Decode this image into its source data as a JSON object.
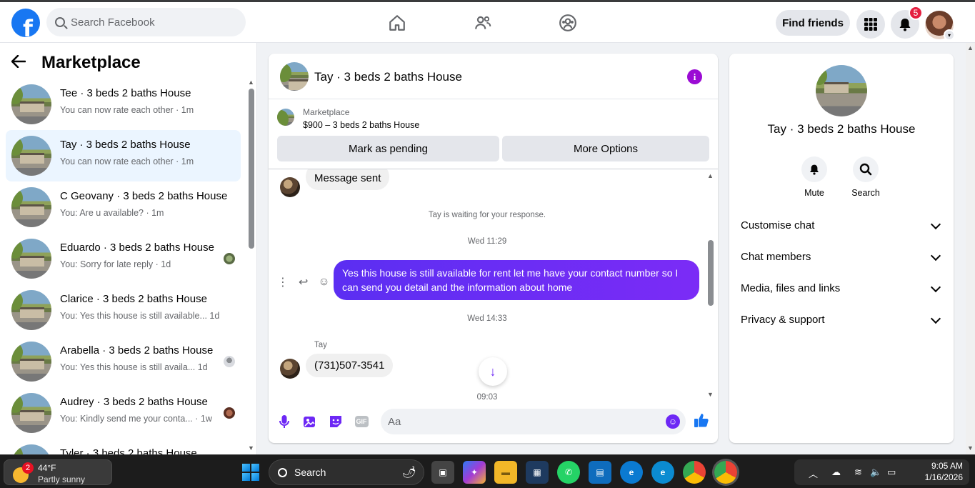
{
  "topbar": {
    "search_placeholder": "Search Facebook",
    "find_friends": "Find friends",
    "notifications_count": "5"
  },
  "left": {
    "title": "Marketplace",
    "conversations": [
      {
        "title": "Tee · 3 beds 2 baths House",
        "snippet": "You can now rate each other · 1m",
        "active": false
      },
      {
        "title": "Tay · 3 beds 2 baths House",
        "snippet": "You can now rate each other · 1m",
        "active": true
      },
      {
        "title": "C Geovany · 3 beds 2 baths House",
        "snippet": "You: Are u available? · 1m",
        "active": false
      },
      {
        "title": "Eduardo · 3 beds 2 baths House",
        "snippet": "You: Sorry for late reply · 1d",
        "active": false
      },
      {
        "title": "Clarice · 3 beds 2 baths House",
        "snippet": "You: Yes this house is still available...  1d",
        "active": false
      },
      {
        "title": "Arabella · 3 beds 2 baths House",
        "snippet": "You: Yes this house is still availa...   1d",
        "active": false
      },
      {
        "title": "Audrey · 3 beds 2 baths House",
        "snippet": "You: Kindly send me your conta... · 1w",
        "active": false
      },
      {
        "title": "Tyler · 3 beds 2 baths House",
        "snippet": "",
        "active": false
      }
    ]
  },
  "chat": {
    "title": "Tay · 3 beds 2 baths House",
    "marketplace_label": "Marketplace",
    "listing": "$900 – 3 beds 2 baths House",
    "btn_pending": "Mark as pending",
    "btn_more": "More Options",
    "messages": {
      "sent_notice": "Message sent",
      "waiting": "Tay is waiting for your response.",
      "time1": "Wed 11:29",
      "outgoing": "Yes this house is still available for rent let me have your contact number so I can send you detail and the information about home",
      "time2": "Wed 14:33",
      "sender_name": "Tay",
      "incoming_phone": "(731)507-3541",
      "time3": "09:03"
    },
    "composer_placeholder": "Aa",
    "accent": "#6d28f5"
  },
  "right": {
    "title": "Tay · 3 beds 2 baths House",
    "mute": "Mute",
    "search": "Search",
    "sections": [
      "Customise chat",
      "Chat members",
      "Media, files and links",
      "Privacy & support"
    ]
  },
  "taskbar": {
    "weather_badge": "2",
    "temp": "44°F",
    "condition": "Partly sunny",
    "search": "Search",
    "time": "9:05 AM",
    "date": "1/16/2026"
  }
}
